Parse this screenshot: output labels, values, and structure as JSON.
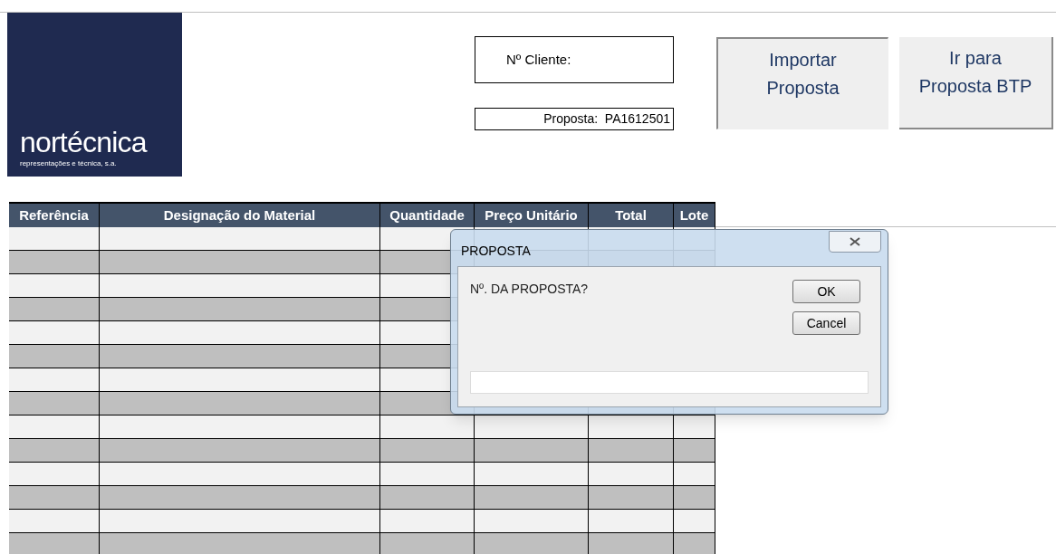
{
  "logo": {
    "name": "nortécnica",
    "tagline": "representações e técnica, s.a."
  },
  "client_field": {
    "label": "Nº Cliente:"
  },
  "proposal_field": {
    "label": "Proposta:",
    "value": "PA1612501"
  },
  "buttons": [
    "Importar Proposta",
    "Ir para Proposta BTP"
  ],
  "table": {
    "columns": [
      "Referência",
      "Designação do Material",
      "Quantidade",
      "Preço Unitário",
      "Total",
      "Lote"
    ],
    "rows": [
      {
        "shaded": false
      },
      {
        "shaded": true
      },
      {
        "shaded": false
      },
      {
        "shaded": true
      },
      {
        "shaded": false
      },
      {
        "shaded": true
      },
      {
        "shaded": false
      },
      {
        "shaded": true
      },
      {
        "shaded": false
      },
      {
        "shaded": true
      },
      {
        "shaded": false
      },
      {
        "shaded": true
      },
      {
        "shaded": false
      },
      {
        "shaded": true
      }
    ]
  },
  "dialog": {
    "title": "PROPOSTA",
    "prompt": "Nº. DA PROPOSTA?",
    "buttons": [
      "OK",
      "Cancel"
    ]
  }
}
